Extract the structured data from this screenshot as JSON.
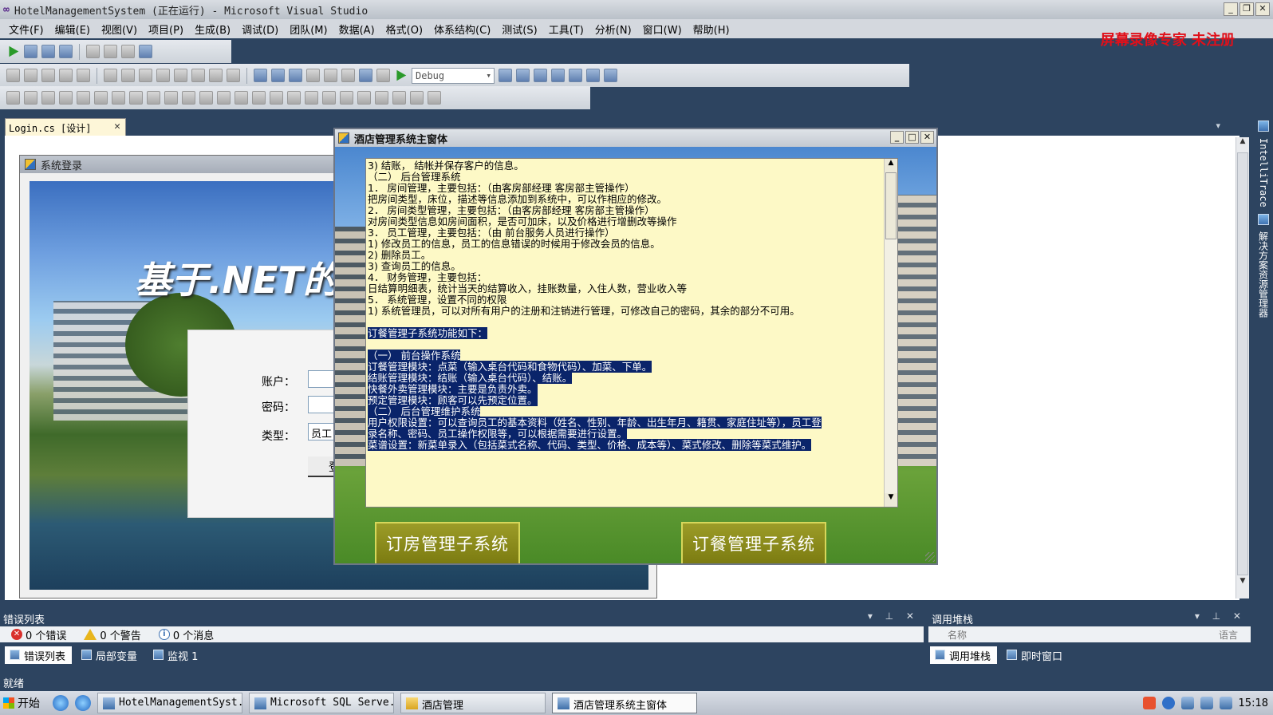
{
  "app": {
    "title": "HotelManagementSystem (正在运行) - Microsoft Visual Studio",
    "watermark": "屏幕录像专家  未注册"
  },
  "menu": [
    "文件(F)",
    "编辑(E)",
    "视图(V)",
    "项目(P)",
    "生成(B)",
    "调试(D)",
    "团队(M)",
    "数据(A)",
    "格式(O)",
    "体系结构(C)",
    "测试(S)",
    "工具(T)",
    "分析(N)",
    "窗口(W)",
    "帮助(H)"
  ],
  "toolbar": {
    "config": "Debug"
  },
  "document_tab": {
    "label": "Login.cs [设计]",
    "close": "✕"
  },
  "login_form": {
    "title": "系统登录",
    "heading": "基于.NET的",
    "account_label": "账户：",
    "password_label": "密码：",
    "type_label": "类型：",
    "type_value": "员工",
    "login_button": "登"
  },
  "main_window": {
    "title": "酒店管理系统主窗体",
    "lines": [
      {
        "text": "3) 结账， 结帐并保存客户的信息。",
        "selected": false
      },
      {
        "text": "（二） 后台管理系统",
        "selected": false
      },
      {
        "text": "1． 房间管理，主要包括：（由客房部经理 客房部主管操作）",
        "selected": false
      },
      {
        "text": "把房间类型，床位，描述等信息添加到系统中，可以作相应的修改。",
        "selected": false
      },
      {
        "text": "2． 房间类型管理，主要包括：（由客房部经理 客房部主管操作）",
        "selected": false
      },
      {
        "text": "对房间类型信息如房间面积，是否可加床，以及价格进行增删改等操作",
        "selected": false
      },
      {
        "text": "3． 员工管理，主要包括：（由 前台服务人员进行操作）",
        "selected": false
      },
      {
        "text": "1) 修改员工的信息，员工的信息错误的时候用于修改会员的信息。",
        "selected": false
      },
      {
        "text": "2) 删除员工。",
        "selected": false
      },
      {
        "text": "3) 查询员工的信息。",
        "selected": false
      },
      {
        "text": "4． 财务管理，主要包括：",
        "selected": false
      },
      {
        "text": "日结算明细表，统计当天的结算收入，挂账数量，入住人数，营业收入等",
        "selected": false
      },
      {
        "text": "5． 系统管理，设置不同的权限",
        "selected": false
      },
      {
        "text": "1) 系统管理员，可以对所有用户的注册和注销进行管理，可修改自己的密码，其余的部分不可用。",
        "selected": false
      },
      {
        "text": "",
        "selected": false
      },
      {
        "text": "订餐管理子系统功能如下：",
        "selected": true
      },
      {
        "text": "",
        "selected": false
      },
      {
        "text": "（一） 前台操作系统",
        "selected": true
      },
      {
        "text": "订餐管理模块：点菜（输入桌台代码和食物代码）、加菜、下单。",
        "selected": true
      },
      {
        "text": "结账管理模块：结账（输入桌台代码）、结账。",
        "selected": true
      },
      {
        "text": "快餐外卖管理模块：主要是负责外卖。",
        "selected": true
      },
      {
        "text": "预定管理模块：顾客可以先预定位置。",
        "selected": true
      },
      {
        "text": "（二） 后台管理维护系统",
        "selected": true
      },
      {
        "text": "用户权限设置：可以查询员工的基本资料（姓名、性别、年龄、出生年月、籍贯、家庭住址等），员工登",
        "selected": true
      },
      {
        "text": "录名称、密码、员工操作权限等，可以根据需要进行设置。",
        "selected": true
      },
      {
        "text": "菜谱设置：新菜单录入（包括菜式名称、代码、类型、价格、成本等）、菜式修改、删除等菜式维护。",
        "selected": true
      }
    ],
    "room_button": "订房管理子系统",
    "dining_button": "订餐管理子系统"
  },
  "side_rail": {
    "intellitrace": "IntelliTrace",
    "solution_explorer": "解决方案资源管理器"
  },
  "error_panel": {
    "title": "错误列表",
    "errors": "0 个错误",
    "warnings": "0 个警告",
    "messages": "0 个消息",
    "tabs": [
      "错误列表",
      "局部变量",
      "监视 1"
    ]
  },
  "call_stack_panel": {
    "title": "调用堆栈",
    "name_col": "名称",
    "lang_col": "语言",
    "tabs": [
      "调用堆栈",
      "即时窗口"
    ]
  },
  "status": "就绪",
  "taskbar": {
    "start": "开始",
    "tasks": [
      "HotelManagementSyst...",
      "Microsoft SQL Serve...",
      "酒店管理",
      "酒店管理系统主窗体"
    ],
    "clock": "15:18"
  }
}
